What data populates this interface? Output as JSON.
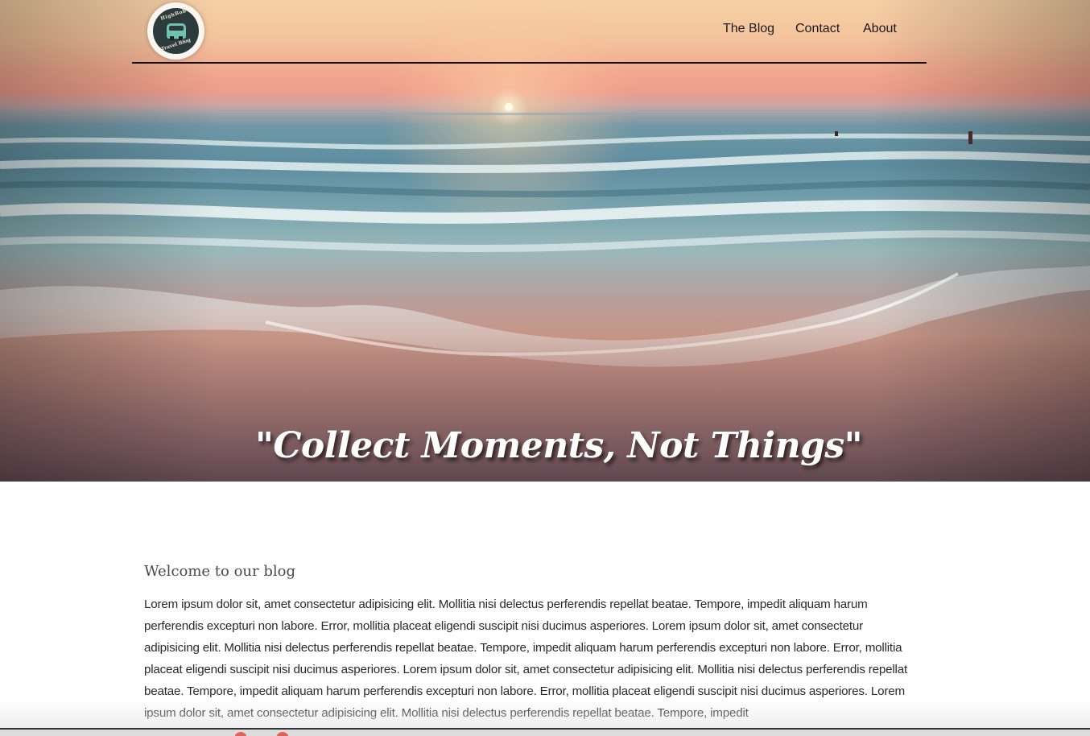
{
  "header": {
    "logo_text_top": "HighBob's",
    "logo_text_bottom": "Travel Blog",
    "nav": [
      {
        "label": "The Blog"
      },
      {
        "label": "Contact"
      },
      {
        "label": "About"
      }
    ]
  },
  "hero": {
    "quote": "\"Collect Moments, Not Things\""
  },
  "content": {
    "heading": "Welcome to our blog",
    "paragraph": "Lorem ipsum dolor sit, amet consectetur adipisicing elit. Mollitia nisi delectus perferendis repellat beatae. Tempore, impedit aliquam harum perferendis excepturi non labore. Error, mollitia placeat eligendi suscipit nisi ducimus asperiores. Lorem ipsum dolor sit, amet consectetur adipisicing elit. Mollitia nisi delectus perferendis repellat beatae. Tempore, impedit aliquam harum perferendis excepturi non labore. Error, mollitia placeat eligendi suscipit nisi ducimus asperiores. Lorem ipsum dolor sit, amet consectetur adipisicing elit. Mollitia nisi delectus perferendis repellat beatae. Tempore, impedit aliquam harum perferendis excepturi non labore. Error, mollitia placeat eligendi suscipit nisi ducimus asperiores. Lorem ipsum dolor sit, amet consectetur adipisicing elit. Mollitia nisi delectus perferendis repellat beatae. Tempore, impedit"
  },
  "colors": {
    "nav_text": "#1a1a1a",
    "quote_text": "#ffffff",
    "heading_text": "#4a4a4a"
  }
}
